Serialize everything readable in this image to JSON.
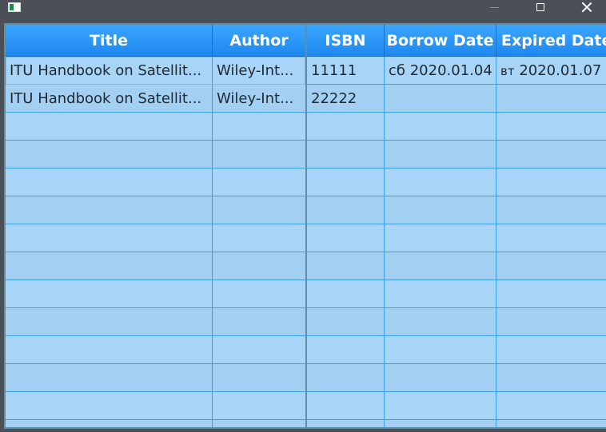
{
  "window": {
    "icon": "app-window-icon",
    "controls": [
      "minimize-icon",
      "maximize-icon",
      "close-icon"
    ]
  },
  "table": {
    "columns": [
      {
        "key": "title",
        "label": "Title"
      },
      {
        "key": "author",
        "label": "Author"
      },
      {
        "key": "isbn",
        "label": "ISBN"
      },
      {
        "key": "borrow_date",
        "label": "Borrow Date"
      },
      {
        "key": "expired_date",
        "label": "Expired Date"
      }
    ],
    "rows": [
      {
        "title": "ITU Handbook on Satellit...",
        "author": "Wiley-Int...",
        "isbn": "11111",
        "borrow_day": "сб",
        "borrow_date": "2020.01.04",
        "expired_day": "вт",
        "expired_date": "2020.01.07"
      },
      {
        "title": "ITU Handbook on Satellit...",
        "author": "Wiley-Int...",
        "isbn": "22222",
        "borrow_day": "",
        "borrow_date": "",
        "expired_day": "",
        "expired_date": ""
      }
    ],
    "selected_row": 0
  }
}
